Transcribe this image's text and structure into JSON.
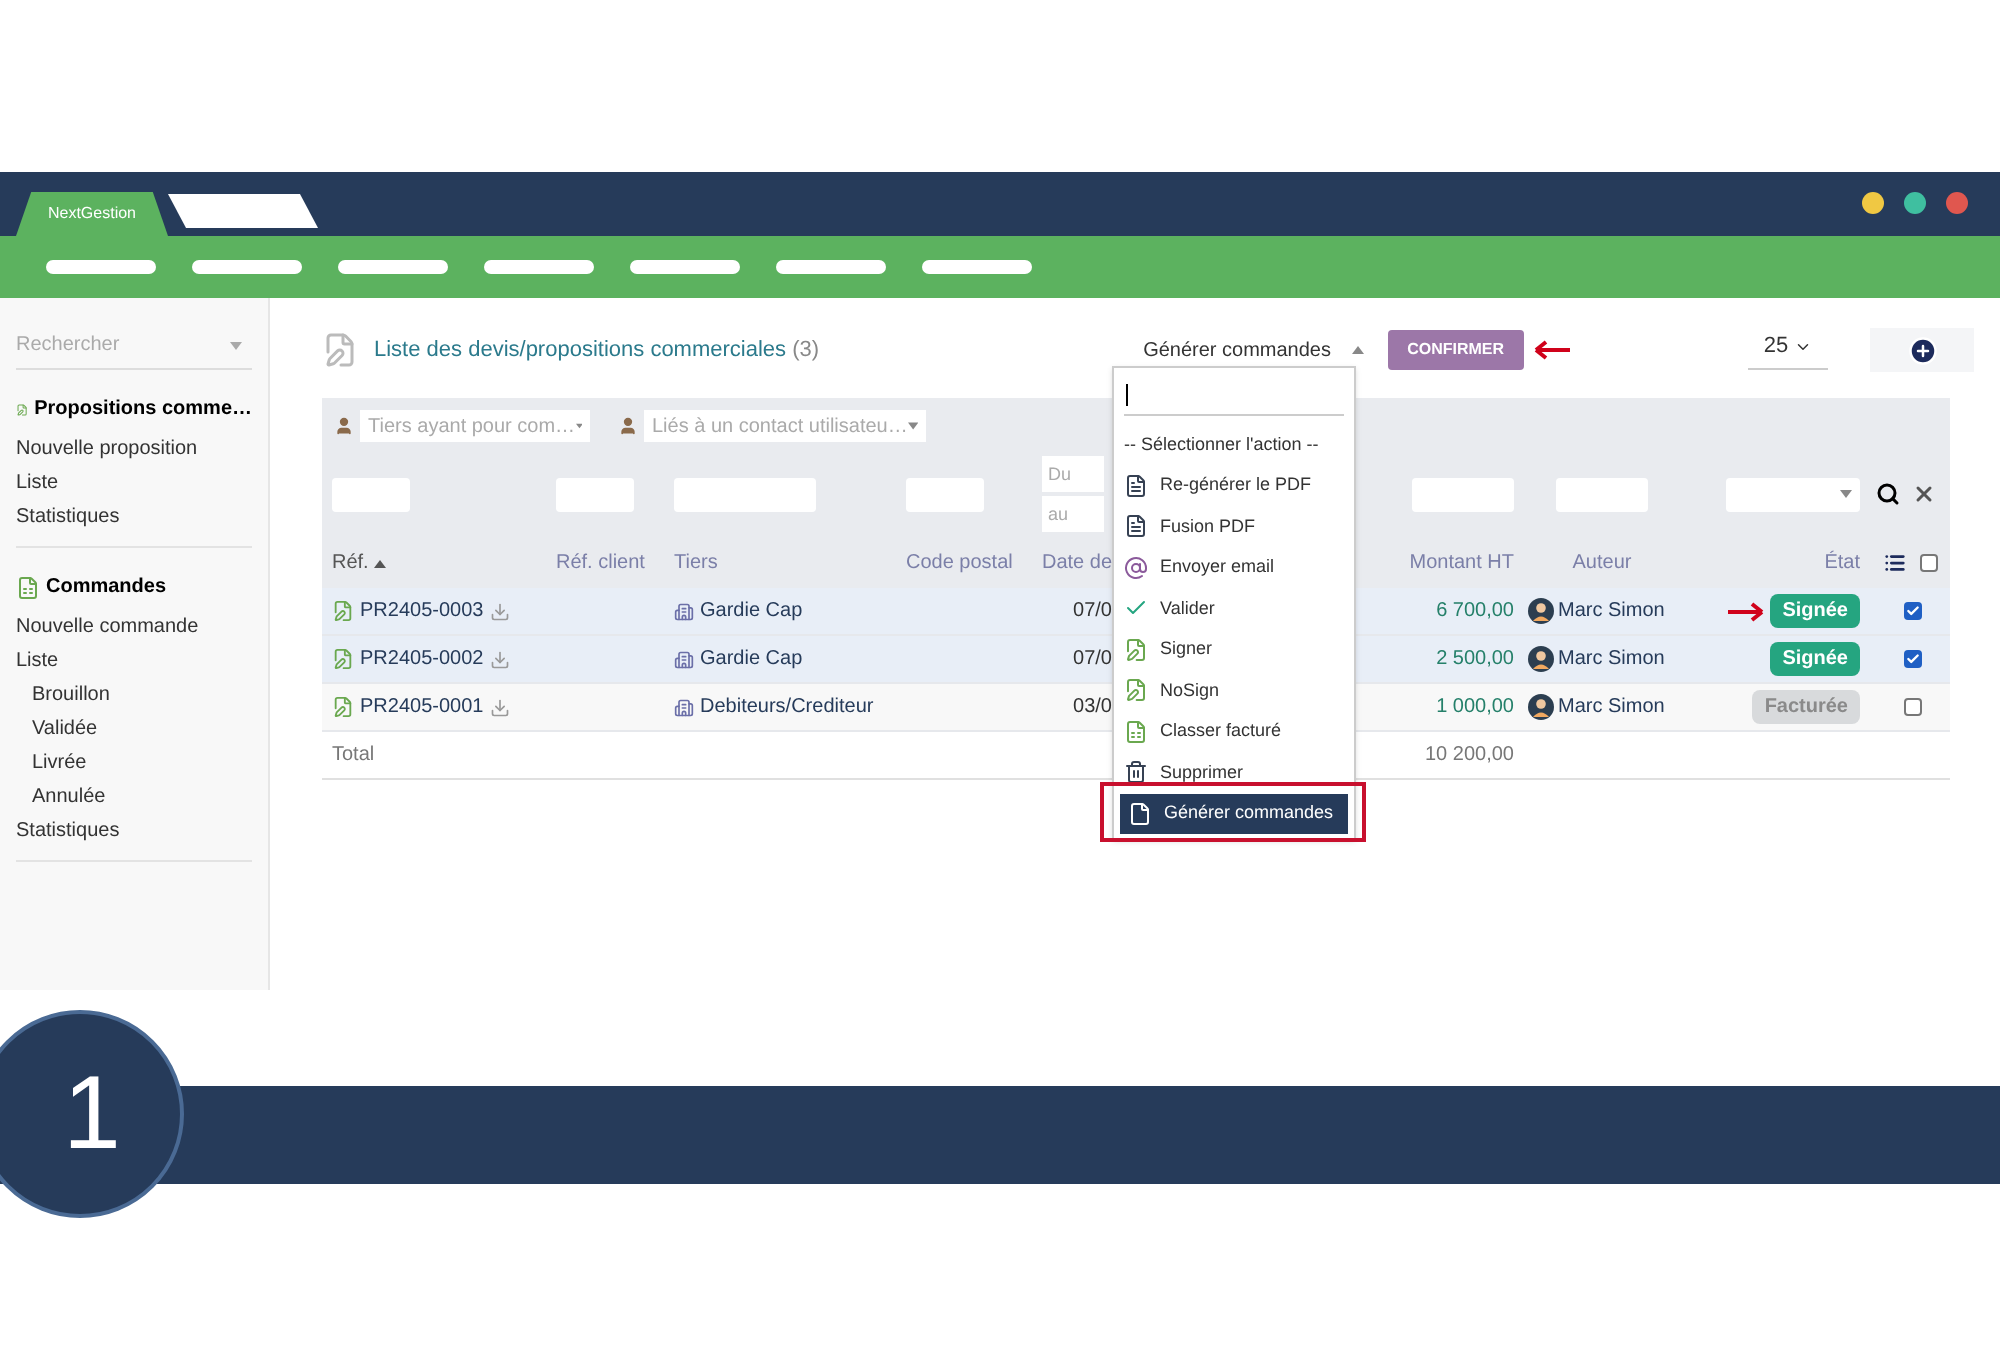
{
  "app_tab": {
    "label": "NextGestion",
    "selected": true
  },
  "sidebar": {
    "search_placeholder": "Rechercher",
    "sections": [
      {
        "title": "Propositions comme…",
        "kind": "proposal",
        "items": [
          {
            "label": "Nouvelle proposition"
          },
          {
            "label": "Liste"
          },
          {
            "label": "Statistiques"
          }
        ]
      },
      {
        "title": "Commandes",
        "kind": "order",
        "items": [
          {
            "label": "Nouvelle commande"
          },
          {
            "label": "Liste",
            "children": [
              {
                "label": "Brouillon"
              },
              {
                "label": "Validée"
              },
              {
                "label": "Livrée"
              },
              {
                "label": "Annulée"
              }
            ]
          },
          {
            "label": "Statistiques"
          }
        ]
      }
    ]
  },
  "header": {
    "title": "Liste des devis/propositions commerciales",
    "count": "(3)",
    "action_value": "Générer commandes",
    "confirm": "CONFIRMER",
    "page_size": "25"
  },
  "filters": {
    "thirdparty_placeholder": "Tiers ayant pour com…",
    "contact_placeholder": "Liés à un contact utilisateu…",
    "date_from": {
      "placeholder": "Du"
    },
    "date_to": {
      "placeholder": "au"
    }
  },
  "select_all": {
    "checked": false
  },
  "columns": [
    {
      "label": "Réf.",
      "sorted": true
    },
    {
      "label": "Réf. client",
      "sorted": false
    },
    {
      "label": "Tiers",
      "sorted": false
    },
    {
      "label": "Code postal",
      "sorted": false
    },
    {
      "label": "Date de",
      "sorted": false
    },
    {
      "label": "Montant HT",
      "sorted": false
    },
    {
      "label": "Auteur",
      "sorted": false
    },
    {
      "label": "État",
      "sorted": false
    }
  ],
  "rows": [
    {
      "ref": "PR2405-0003",
      "tiers": "Gardie Cap",
      "date": "07/0",
      "amount": "6 700,00",
      "author": "Marc Simon",
      "status": {
        "label": "Signée",
        "kind": "signed"
      },
      "selected": true,
      "annotated": true
    },
    {
      "ref": "PR2405-0002",
      "tiers": "Gardie Cap",
      "date": "07/0",
      "amount": "2 500,00",
      "author": "Marc Simon",
      "status": {
        "label": "Signée",
        "kind": "signed"
      },
      "selected": true,
      "annotated": false
    },
    {
      "ref": "PR2405-0001",
      "tiers": "Debiteurs/Crediteur",
      "date": "03/0",
      "amount": "1 000,00",
      "author": "Marc Simon",
      "status": {
        "label": "Facturée",
        "kind": "billed"
      },
      "selected": false,
      "annotated": false
    }
  ],
  "total": {
    "label": "Total",
    "amount": "10 200,00"
  },
  "dropdown": {
    "items": [
      {
        "label": "-- Sélectionner l'action --",
        "kind": "none",
        "selected": false
      },
      {
        "label": "Re-générer le PDF",
        "kind": "pdf",
        "selected": false
      },
      {
        "label": "Fusion PDF",
        "kind": "pdf",
        "selected": false
      },
      {
        "label": "Envoyer email",
        "kind": "email",
        "selected": false
      },
      {
        "label": "Valider",
        "kind": "check",
        "selected": false
      },
      {
        "label": "Signer",
        "kind": "sign",
        "selected": false
      },
      {
        "label": "NoSign",
        "kind": "sign",
        "selected": false
      },
      {
        "label": "Classer facturé",
        "kind": "billed",
        "selected": false
      },
      {
        "label": "Supprimer",
        "kind": "trash",
        "selected": false
      },
      {
        "label": "Générer commandes",
        "kind": "order",
        "selected": true
      }
    ]
  },
  "step": "1"
}
